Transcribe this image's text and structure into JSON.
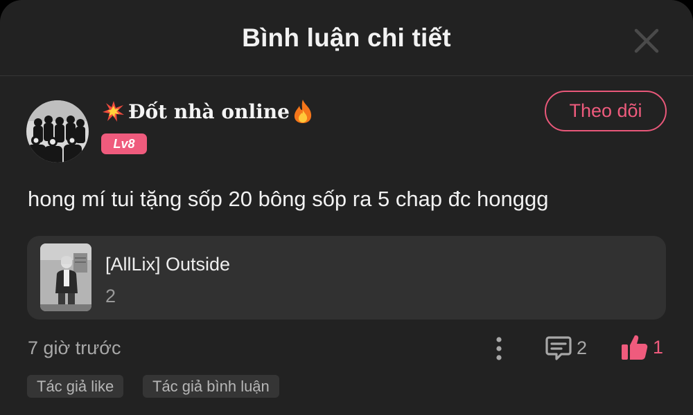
{
  "header": {
    "title": "Bình luận chi tiết",
    "close_icon": "close-icon"
  },
  "user": {
    "avatar_icon": "user-avatar-photo",
    "name": "Đốt nhà online",
    "name_prefix_icon": "collision-emoji",
    "name_suffix_icon": "fire-emoji",
    "level": "Lv8"
  },
  "follow_button": {
    "label": "Theo dõi"
  },
  "comment": {
    "text": "hong mí tui tặng sốp 20 bông sốp ra 5 chap đc honggg"
  },
  "story": {
    "thumbnail_icon": "story-cover-image",
    "title": "[AllLix] Outside",
    "chapter": "2"
  },
  "meta": {
    "timestamp": "7 giờ trước",
    "more_icon": "more-vertical-icon",
    "reply_icon": "comment-icon",
    "reply_count": "2",
    "like_icon": "thumbs-up-icon",
    "like_count": "1"
  },
  "tags": [
    {
      "label": "Tác giả like"
    },
    {
      "label": "Tác giả bình luận"
    }
  ],
  "colors": {
    "background": "#222222",
    "accent": "#ef5b7d",
    "card": "#313131",
    "muted_text": "#a8a8a8"
  }
}
